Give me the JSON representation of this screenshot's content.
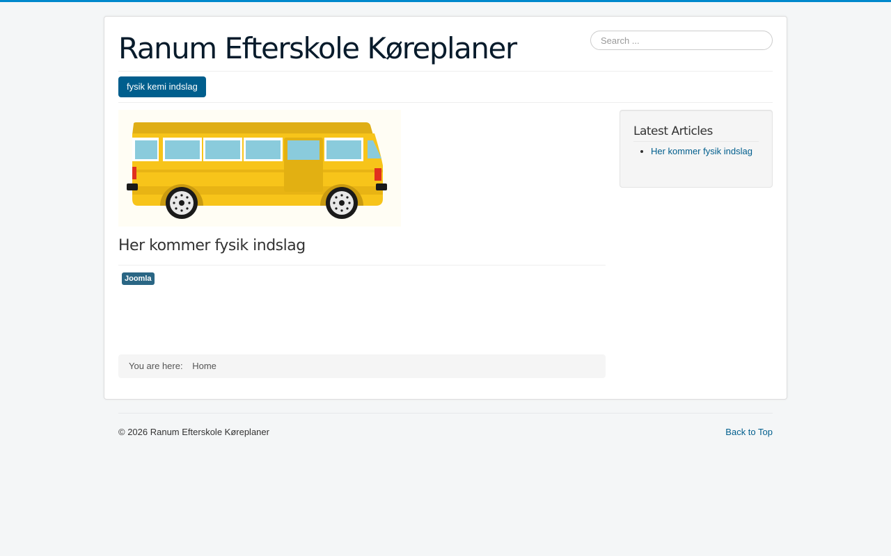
{
  "colors": {
    "accent": "#0088cc",
    "nav_active": "#005e8d",
    "tag": "#2a6684",
    "link": "#005e8d",
    "bus_yellow": "#f5c518"
  },
  "header": {
    "site_title": "Ranum Efterskole Køreplaner",
    "search_placeholder": "Search ..."
  },
  "nav": {
    "items": [
      {
        "label": "fysik kemi indslag",
        "active": true
      }
    ]
  },
  "article": {
    "image_icon": "school-bus-illustration",
    "title": "Her kommer fysik indslag",
    "tags": [
      "Joomla"
    ]
  },
  "breadcrumb": {
    "prefix": "You are here:",
    "items": [
      "Home"
    ]
  },
  "sidebar": {
    "module_title": "Latest Articles",
    "items": [
      {
        "label": "Her kommer fysik indslag"
      }
    ]
  },
  "footer": {
    "copyright": "© 2026 Ranum Efterskole Køreplaner",
    "back_to_top": "Back to Top"
  }
}
